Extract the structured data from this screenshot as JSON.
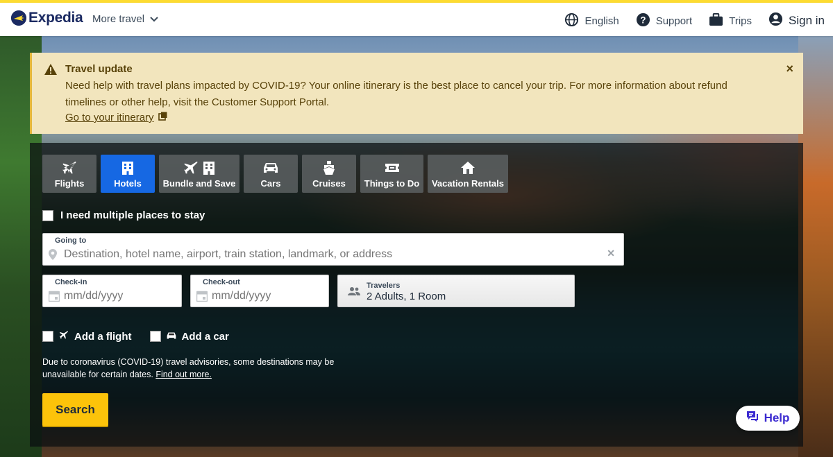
{
  "header": {
    "logo_text": "Expedia",
    "more_travel": "More travel",
    "language": "English",
    "support": "Support",
    "trips": "Trips",
    "sign_in": "Sign in"
  },
  "alert": {
    "title": "Travel update",
    "body": "Need help with travel plans impacted by COVID-19? Your online itinerary is the best place to cancel your trip. For more information about refund timelines or other help, visit the Customer Support Portal.",
    "link": "Go to your itinerary",
    "close": "×"
  },
  "tabs": [
    {
      "label": "Flights",
      "icon": "plane-icon",
      "active": false
    },
    {
      "label": "Hotels",
      "icon": "hotel-icon",
      "active": true
    },
    {
      "label": "Bundle and Save",
      "icon": "bundle-icon",
      "active": false
    },
    {
      "label": "Cars",
      "icon": "car-icon",
      "active": false
    },
    {
      "label": "Cruises",
      "icon": "cruise-icon",
      "active": false
    },
    {
      "label": "Things to Do",
      "icon": "ticket-icon",
      "active": false
    },
    {
      "label": "Vacation Rentals",
      "icon": "house-icon",
      "active": false
    }
  ],
  "form": {
    "multiple_places": "I need multiple places to stay",
    "going_to_label": "Going to",
    "going_to_placeholder": "Destination, hotel name, airport, train station, landmark, or address",
    "checkin_label": "Check-in",
    "checkin_placeholder": "mm/dd/yyyy",
    "checkout_label": "Check-out",
    "checkout_placeholder": "mm/dd/yyyy",
    "travelers_label": "Travelers",
    "travelers_value": "2 Adults, 1 Room",
    "add_flight": "Add a flight",
    "add_car": "Add a car",
    "advisory": "Due to coronavirus (COVID-19) travel advisories, some destinations may be unavailable for certain dates.",
    "advisory_link": "Find out more.",
    "search": "Search"
  },
  "help": "Help",
  "colors": {
    "accent": "#1668e3",
    "brand": "#1b2a62",
    "search_button": "#fcc30a",
    "top_bar": "#fddb32",
    "alert_bg": "#f2e5bd"
  }
}
